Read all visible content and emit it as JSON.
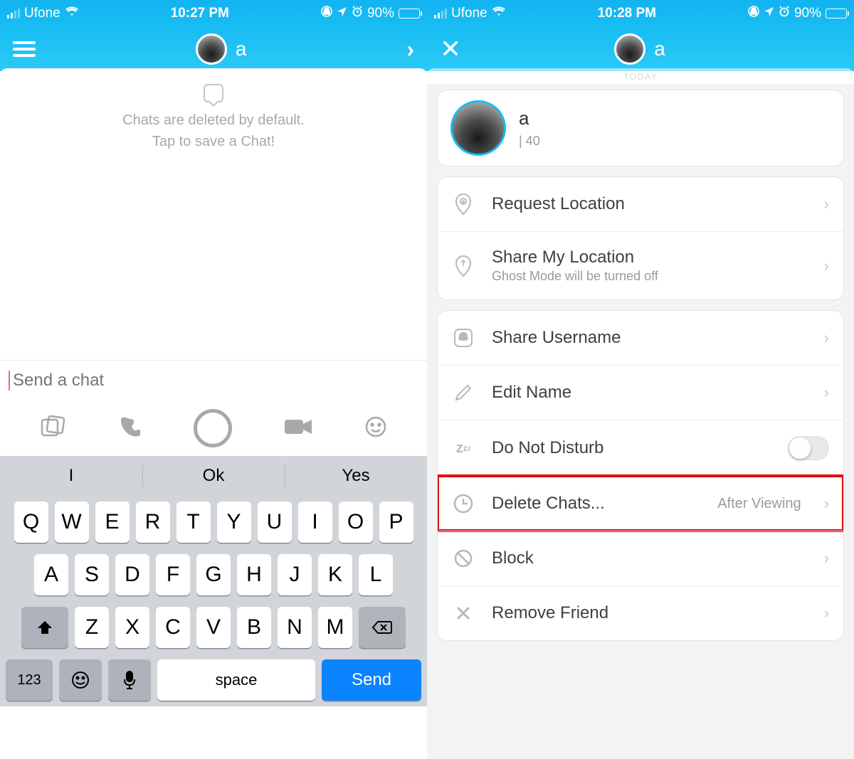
{
  "status": {
    "carrier": "Ufone",
    "time_left": "10:27 PM",
    "time_right": "10:28 PM",
    "battery": "90%"
  },
  "left": {
    "contact_name": "a",
    "hint_line1": "Chats are deleted by default.",
    "hint_line2": "Tap to save a Chat!",
    "input_placeholder": "Send a chat"
  },
  "keyboard": {
    "suggestions": [
      "I",
      "Ok",
      "Yes"
    ],
    "row1": [
      "Q",
      "W",
      "E",
      "R",
      "T",
      "Y",
      "U",
      "I",
      "O",
      "P"
    ],
    "row2": [
      "A",
      "S",
      "D",
      "F",
      "G",
      "H",
      "J",
      "K",
      "L"
    ],
    "row3": [
      "Z",
      "X",
      "C",
      "V",
      "B",
      "N",
      "M"
    ],
    "num": "123",
    "space": "space",
    "send": "Send"
  },
  "right": {
    "today": "TODAY",
    "contact_name": "a",
    "profile_sub": "| 40",
    "sections": {
      "loc": {
        "request": "Request Location",
        "share": "Share My Location",
        "share_sub": "Ghost Mode will be turned off"
      },
      "settings": {
        "share_username": "Share Username",
        "edit_name": "Edit Name",
        "dnd": "Do Not Disturb",
        "delete_chats": "Delete Chats...",
        "delete_value": "After Viewing",
        "block": "Block",
        "remove": "Remove Friend"
      }
    }
  }
}
